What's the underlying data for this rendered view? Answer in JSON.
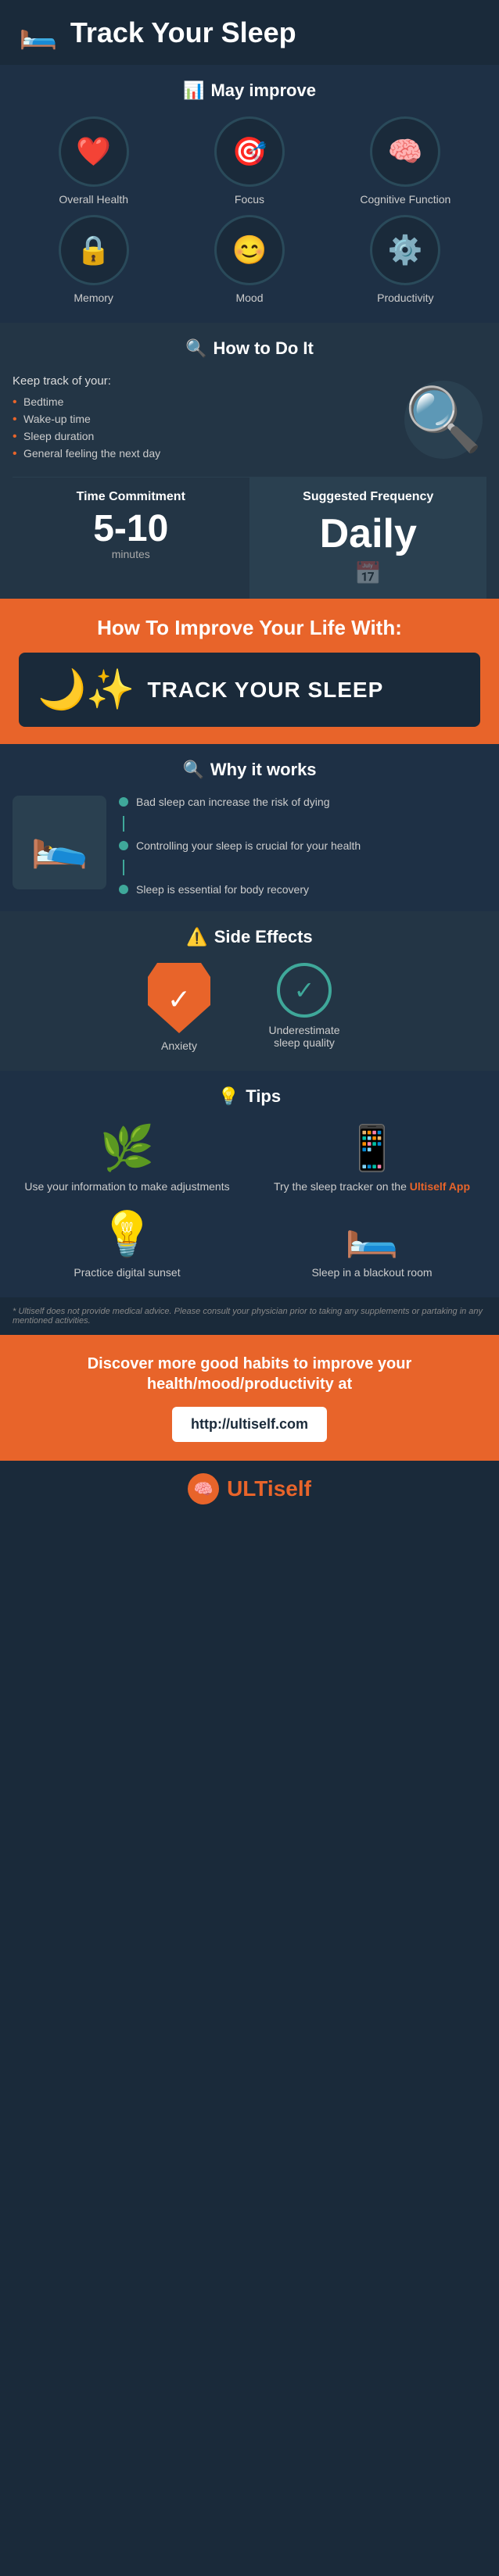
{
  "header": {
    "icon": "🛏️",
    "title": "Track Your Sleep"
  },
  "may_improve": {
    "section_title": "May improve",
    "section_icon": "📊",
    "items": [
      {
        "id": "overall-health",
        "icon": "❤️",
        "label": "Overall Health"
      },
      {
        "id": "focus",
        "icon": "🎯",
        "label": "Focus"
      },
      {
        "id": "cognitive",
        "icon": "🧠",
        "label": "Cognitive Function"
      },
      {
        "id": "memory",
        "icon": "🔒",
        "label": "Memory"
      },
      {
        "id": "mood",
        "icon": "😊",
        "label": "Mood"
      },
      {
        "id": "productivity",
        "icon": "⚙️",
        "label": "Productivity"
      }
    ]
  },
  "how_to": {
    "section_title": "How to Do It",
    "section_icon": "🔍",
    "keep_track_label": "Keep track of your:",
    "bullets": [
      "Bedtime",
      "Wake-up time",
      "Sleep duration",
      "General feeling the next day"
    ]
  },
  "time_commitment": {
    "header": "Time Commitment",
    "value": "5-10",
    "unit": "minutes"
  },
  "suggested_frequency": {
    "header": "Suggested Frequency",
    "value": "Daily"
  },
  "improve_life": {
    "title": "How To Improve Your Life With:",
    "banner_text": "TRACK YOUR SLEEP"
  },
  "why_works": {
    "section_title": "Why it works",
    "section_icon": "🔍",
    "points": [
      "Bad sleep can increase the risk of dying",
      "Controlling your sleep is crucial for your health",
      "Sleep is essential for body recovery"
    ]
  },
  "side_effects": {
    "section_title": "Side Effects",
    "section_icon": "⚠️",
    "items": [
      {
        "id": "anxiety",
        "label": "Anxiety",
        "type": "shield"
      },
      {
        "id": "underestimate",
        "label": "Underestimate sleep quality",
        "type": "check"
      }
    ]
  },
  "tips": {
    "section_title": "Tips",
    "section_icon": "💡",
    "items": [
      {
        "id": "adjustments",
        "icon": "🌿",
        "label": "Use your information to make adjustments",
        "highlight": null
      },
      {
        "id": "tracker",
        "icon": "📱",
        "label_parts": [
          "Try the sleep tracker on the ",
          "Ultiself App"
        ],
        "has_highlight": true
      },
      {
        "id": "digital-sunset",
        "icon": "💡",
        "label": "Practice digital sunset",
        "highlight": null
      },
      {
        "id": "blackout",
        "icon": "🛏️",
        "label": "Sleep in a blackout room",
        "highlight": null
      }
    ]
  },
  "disclaimer": "* Ultiself does not provide medical advice. Please consult your physician prior to taking any supplements or partaking in any mentioned activities.",
  "footer_cta": {
    "text": "Discover more good habits to improve your health/mood/productivity at",
    "url": "http://ultiself.com"
  },
  "logo": {
    "icon": "🧠",
    "text_prefix": "ULTi",
    "text_suffix": "self"
  }
}
